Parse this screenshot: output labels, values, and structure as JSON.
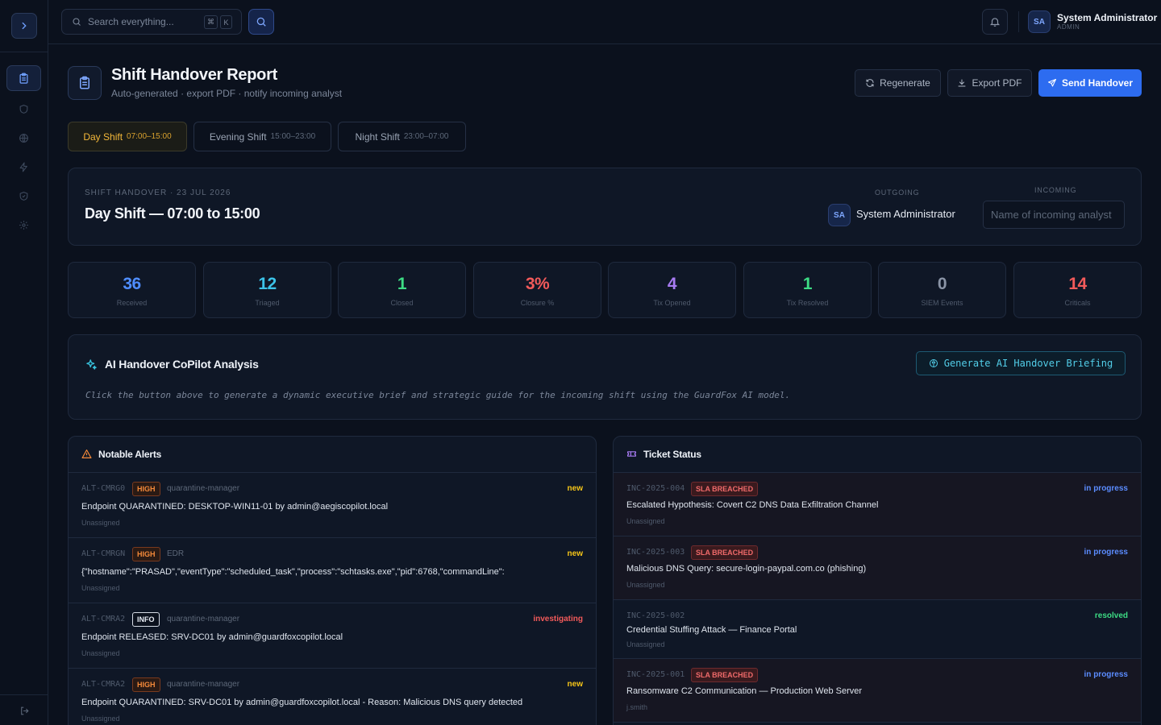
{
  "topbar": {
    "search_placeholder": "Search everything...",
    "kbd1": "⌘",
    "kbd2": "K",
    "user_initials": "SA",
    "user_name": "System Administrator",
    "user_role": "ADMIN"
  },
  "header": {
    "title": "Shift Handover Report",
    "subtitle": "Auto-generated · export PDF · notify incoming analyst",
    "regenerate_label": "Regenerate",
    "export_label": "Export PDF",
    "send_label": "Send Handover"
  },
  "shifts": [
    {
      "name": "Day Shift",
      "time": "07:00–15:00"
    },
    {
      "name": "Evening Shift",
      "time": "15:00–23:00"
    },
    {
      "name": "Night Shift",
      "time": "23:00–07:00"
    }
  ],
  "handover": {
    "meta": "SHIFT HANDOVER · 23 JUL 2026",
    "title": "Day Shift — 07:00 to 15:00",
    "outgoing_label": "OUTGOING",
    "outgoing_initials": "SA",
    "outgoing_name": "System Administrator",
    "incoming_label": "INCOMING",
    "incoming_placeholder": "Name of incoming analyst"
  },
  "stats": [
    {
      "value": "36",
      "label": "Received",
      "color": "#4f8dff"
    },
    {
      "value": "12",
      "label": "Triaged",
      "color": "#3cc3e8"
    },
    {
      "value": "1",
      "label": "Closed",
      "color": "#3ddc84"
    },
    {
      "value": "3%",
      "label": "Closure %",
      "color": "#f25a5a"
    },
    {
      "value": "4",
      "label": "Tix Opened",
      "color": "#a77bf2"
    },
    {
      "value": "1",
      "label": "Tix Resolved",
      "color": "#3ddc84"
    },
    {
      "value": "0",
      "label": "SIEM Events",
      "color": "#8a94a6"
    },
    {
      "value": "14",
      "label": "Criticals",
      "color": "#f25a5a"
    }
  ],
  "ai": {
    "title": "AI Handover CoPilot Analysis",
    "button": "Generate AI Handover Briefing",
    "description": "Click the button above to generate a dynamic executive brief and strategic guide for the incoming shift using the GuardFox AI model."
  },
  "alerts": {
    "title": "Notable Alerts",
    "items": [
      {
        "id": "ALT-CMRG0",
        "severity": "HIGH",
        "source": "quarantine-manager",
        "status": "new",
        "text": "Endpoint QUARANTINED: DESKTOP-WIN11-01 by admin@aegiscopilot.local",
        "assignee": "Unassigned"
      },
      {
        "id": "ALT-CMRGN",
        "severity": "HIGH",
        "source": "EDR",
        "status": "new",
        "text": "{\"hostname\":\"PRASAD\",\"eventType\":\"scheduled_task\",\"process\":\"schtasks.exe\",\"pid\":6768,\"commandLine\":",
        "assignee": "Unassigned"
      },
      {
        "id": "ALT-CMRA2",
        "severity": "INFO",
        "source": "quarantine-manager",
        "status": "investigating",
        "text": "Endpoint RELEASED: SRV-DC01 by admin@guardfoxcopilot.local",
        "assignee": "Unassigned"
      },
      {
        "id": "ALT-CMRA2",
        "severity": "HIGH",
        "source": "quarantine-manager",
        "status": "new",
        "text": "Endpoint QUARANTINED: SRV-DC01 by admin@guardfoxcopilot.local - Reason: Malicious DNS query detected",
        "assignee": "Unassigned"
      }
    ]
  },
  "tickets": {
    "title": "Ticket Status",
    "items": [
      {
        "id": "INC-2025-004",
        "badge": "SLA BREACHED",
        "status": "in progress",
        "text": "Escalated Hypothesis: Covert C2 DNS Data Exfiltration Channel",
        "assignee": "Unassigned"
      },
      {
        "id": "INC-2025-003",
        "badge": "SLA BREACHED",
        "status": "in progress",
        "text": "Malicious DNS Query: secure-login-paypal.com.co (phishing)",
        "assignee": "Unassigned"
      },
      {
        "id": "INC-2025-002",
        "badge": "",
        "status": "resolved",
        "text": "Credential Stuffing Attack — Finance Portal",
        "assignee": "Unassigned"
      },
      {
        "id": "INC-2025-001",
        "badge": "SLA BREACHED",
        "status": "in progress",
        "text": "Ransomware C2 Communication — Production Web Server",
        "assignee": "j.smith"
      }
    ]
  },
  "colors": {
    "status_new": "#f5c518",
    "status_investigating": "#f25a5a",
    "status_in_progress": "#5b8cff",
    "status_resolved": "#3ddc84"
  }
}
